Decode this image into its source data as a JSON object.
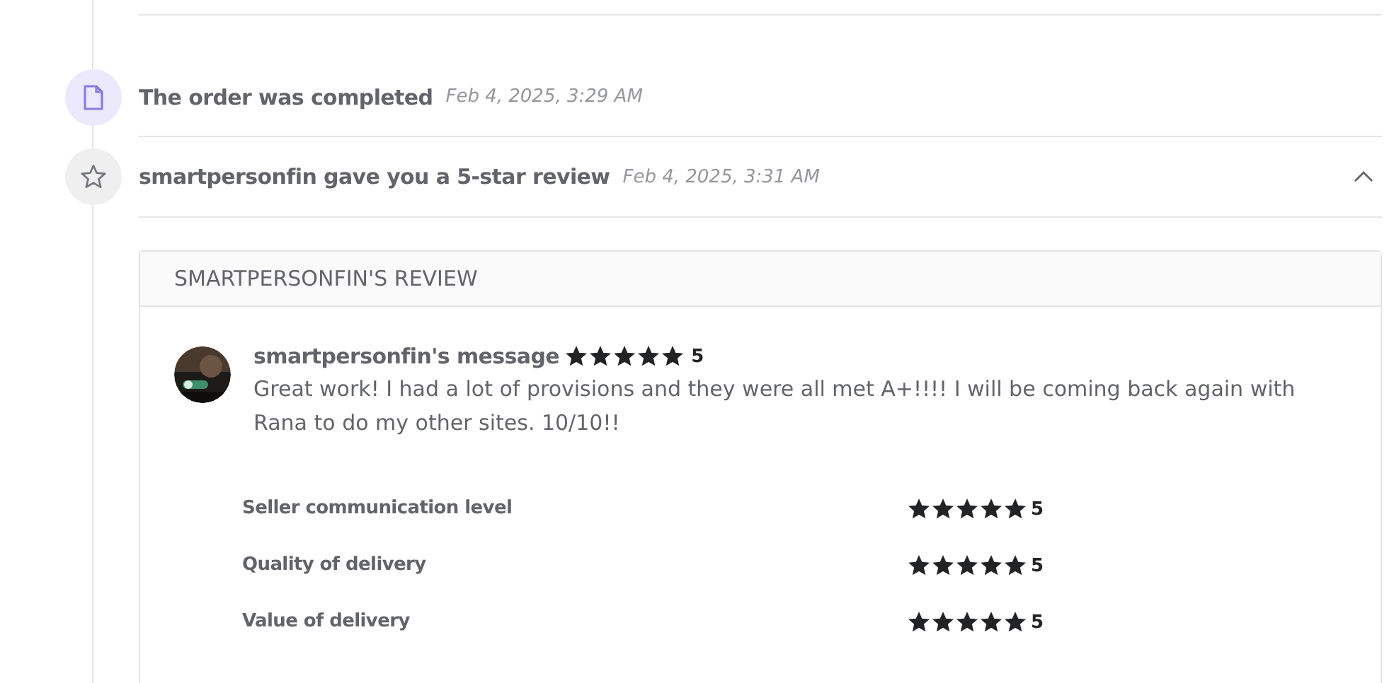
{
  "events": [
    {
      "kind": "document",
      "title": "The order was completed",
      "time": "Feb 4, 2025, 3:29 AM"
    },
    {
      "kind": "star",
      "title": "smartpersonfin gave you a 5-star review",
      "time": "Feb 4, 2025, 3:31 AM",
      "expanded": true
    }
  ],
  "review": {
    "heading": "SMARTPERSONFIN'S REVIEW",
    "message": {
      "author": "smartpersonfin's message",
      "stars": 5,
      "score": "5",
      "text": "Great work! I had a lot of provisions and they were all met A+!!!! I will be coming back again with Rana to do my other sites. 10/10!!"
    },
    "ratings": [
      {
        "label": "Seller communication level",
        "stars": 5,
        "score": "5"
      },
      {
        "label": "Quality of delivery",
        "stars": 5,
        "score": "5"
      },
      {
        "label": "Value of delivery",
        "stars": 5,
        "score": "5"
      }
    ]
  }
}
